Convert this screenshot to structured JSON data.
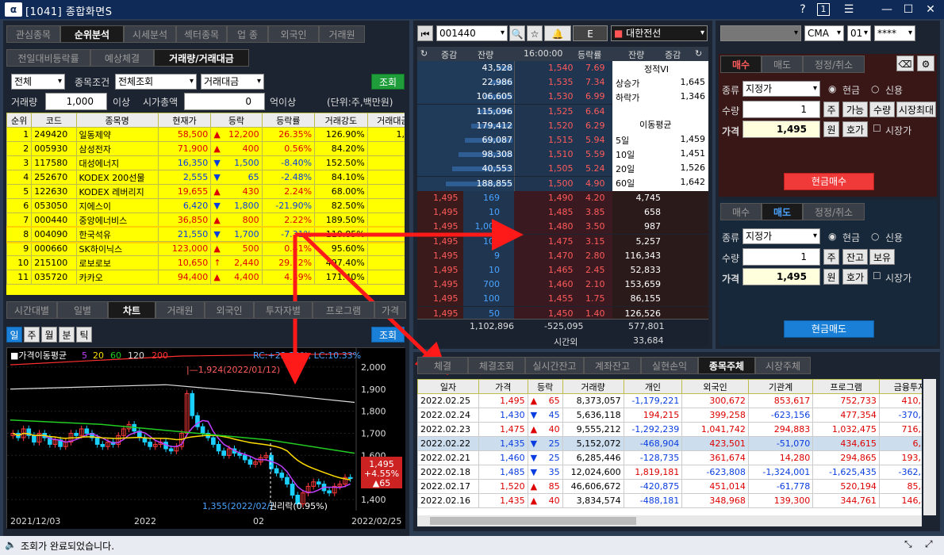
{
  "title": "[1041] 종합화면S",
  "title_buttons": [
    "?",
    "1",
    "☰",
    "—",
    "☐",
    "✕"
  ],
  "left": {
    "tabs1": [
      "관심종목",
      "순위분석",
      "시세분석",
      "섹터종목",
      "업 종",
      "외국인",
      "거래원"
    ],
    "tabs2": [
      "전일대비등락률",
      "예상체결",
      "거래량/거래대금"
    ],
    "market": "전체",
    "cond_label": "종목조건",
    "cond": "전체조회",
    "sort": "거래대금",
    "search": "조회",
    "vol_label": "거래량",
    "vol": "1,000",
    "vol_unit": "이상",
    "amt_label": "시가총액",
    "amt": "0",
    "amt_unit": "억이상",
    "unit": "(단위:주,백만원)",
    "cols": [
      "순위",
      "코드",
      "종목명",
      "현재가",
      "등락",
      "등락률",
      "거래강도",
      "거래대금"
    ],
    "rows": [
      [
        "1",
        "249420",
        "일동제약",
        "58,500",
        "▲",
        "12,200",
        "26.35%",
        "126.90%",
        "1,05"
      ],
      [
        "2",
        "005930",
        "삼성전자",
        "71,900",
        "▲",
        "400",
        "0.56%",
        "84.20%",
        "95"
      ],
      [
        "3",
        "117580",
        "대성에너지",
        "16,350",
        "▼",
        "1,500",
        "-8.40%",
        "152.50%",
        "70"
      ],
      [
        "4",
        "252670",
        "KODEX 200선물",
        "2,555",
        "▼",
        "65",
        "-2.48%",
        "84.10%",
        "60"
      ],
      [
        "5",
        "122630",
        "KODEX 레버리지",
        "19,655",
        "▲",
        "430",
        "2.24%",
        "68.00%",
        "50"
      ],
      [
        "6",
        "053050",
        "지에스이",
        "6,420",
        "▼",
        "1,800",
        "-21.90%",
        "82.50%",
        "50"
      ],
      [
        "7",
        "000440",
        "중앙에너비스",
        "36,850",
        "▲",
        "800",
        "2.22%",
        "189.50%",
        "43"
      ],
      [
        "8",
        "004090",
        "한국석유",
        "21,550",
        "▼",
        "1,700",
        "-7.31%",
        "110.85%",
        "42"
      ],
      [
        "9",
        "000660",
        "SK하이닉스",
        "123,000",
        "▲",
        "500",
        "0.41%",
        "95.60%",
        "41"
      ],
      [
        "10",
        "215100",
        "로보로보",
        "10,650",
        "↑",
        "2,440",
        "29.72%",
        "497.40%",
        "37"
      ],
      [
        "11",
        "035720",
        "카카오",
        "94,400",
        "▲",
        "4,400",
        "4.89%",
        "171.40%",
        "34"
      ]
    ],
    "tabs3": [
      "시간대별",
      "일별",
      "차트",
      "거래원",
      "외국인",
      "투자자별",
      "프로그램",
      "가격"
    ],
    "periods": [
      "일",
      "주",
      "월",
      "분",
      "틱"
    ],
    "search2": "조회",
    "chart": {
      "legend": "가격이동평균",
      "ma": [
        "5",
        "20",
        "60",
        "120",
        "200"
      ],
      "rc": "RC:+22.29%, LC:10.33%",
      "high_note": "1,924(2022/01/12)",
      "low_note": "1,355(2022/02/)",
      "event": "권리락(0.95%)",
      "last": "1,495",
      "chg": "+4.55%",
      "chg2": "▲65",
      "yticks": [
        "2,000",
        "1,900",
        "1,800",
        "1,700",
        "1,600",
        "1,500",
        "1,400"
      ],
      "xticks": [
        "2021/12/03",
        "2022",
        "02",
        "2022/02/25"
      ]
    }
  },
  "mid": {
    "code": "001440",
    "btn_e": "E",
    "name": "대한전선",
    "time": "16:00:00",
    "hdr": [
      "증감",
      "잔량",
      "16:00:00",
      "등락률",
      "잔량",
      "증감"
    ],
    "asks": [
      [
        "43,528",
        "1,540",
        "7.69"
      ],
      [
        "22,986",
        "1,535",
        "7.34"
      ],
      [
        "106,605",
        "1,530",
        "6.99"
      ],
      [
        "115,096",
        "1,525",
        "6.64"
      ],
      [
        "179,412",
        "1,520",
        "6.29"
      ],
      [
        "69,087",
        "1,515",
        "5.94"
      ],
      [
        "98,308",
        "1,510",
        "5.59"
      ],
      [
        "40,553",
        "1,505",
        "5.24"
      ],
      [
        "188,855",
        "1,500",
        "4.90"
      ],
      [
        "238,466",
        "1,495",
        "4.55"
      ]
    ],
    "bids": [
      [
        "1,495",
        "169",
        "1,490",
        "4.20",
        "4,745"
      ],
      [
        "1,495",
        "10",
        "1,485",
        "3.85",
        "658"
      ],
      [
        "1,495",
        "1,000",
        "1,480",
        "3.50",
        "987"
      ],
      [
        "1,495",
        "100",
        "1,475",
        "3.15",
        "5,257"
      ],
      [
        "1,495",
        "9",
        "1,470",
        "2.80",
        "116,343"
      ],
      [
        "1,495",
        "10",
        "1,465",
        "2.45",
        "52,833"
      ],
      [
        "1,495",
        "700",
        "1,460",
        "2.10",
        "153,659"
      ],
      [
        "1,495",
        "100",
        "1,455",
        "1.75",
        "86,155"
      ],
      [
        "1,495",
        "50",
        "1,450",
        "1.40",
        "126,526"
      ],
      [
        "1,495",
        "1,933",
        "1,445",
        "1.05",
        "30,638"
      ]
    ],
    "info": [
      [
        "정적VI",
        ""
      ],
      [
        "상승가",
        "1,645"
      ],
      [
        "하락가",
        "1,346"
      ]
    ],
    "ma_title": "이동평균",
    "ma": [
      [
        "5일",
        "1,459"
      ],
      [
        "10일",
        "1,451"
      ],
      [
        "20일",
        "1,526"
      ],
      [
        "60일",
        "1,642"
      ]
    ],
    "tot_ask": "1,102,896",
    "tot_diff": "-525,095",
    "tot_bid": "577,801",
    "after": "시간외",
    "after_val": "33,684"
  },
  "right": {
    "acct": "CMA",
    "sub": "01",
    "pw": "****",
    "buy_tabs": [
      "매수",
      "매도",
      "정정/취소"
    ],
    "kind_label": "종류",
    "kind": "지정가",
    "cash": "현금",
    "credit": "신용",
    "qty_label": "수량",
    "qty": "1",
    "price_label": "가격",
    "price": "1,495",
    "b_ju": "주",
    "b_avail": "가능",
    "b_qty": "수량",
    "b_max": "시장최대",
    "b_won": "원",
    "b_ho": "호가",
    "market_price": "시장가",
    "buy_btn": "현금매수",
    "sell_btn": "현금매도",
    "b_jan": "잔고",
    "b_bo": "보유"
  },
  "bottom": {
    "tabs": [
      "체결",
      "체결조회",
      "실시간잔고",
      "계좌잔고",
      "실현손익",
      "종목주체",
      "시장주체"
    ],
    "cols": [
      "일자",
      "가격",
      "등락",
      "거래량",
      "개인",
      "외국인",
      "기관계",
      "프로그램",
      "금융투자"
    ],
    "rows": [
      [
        "2022.02.25",
        "1,495",
        "▲",
        "65",
        "8,373,057",
        "-1,179,221",
        "300,672",
        "853,617",
        "752,733",
        "410,910"
      ],
      [
        "2022.02.24",
        "1,430",
        "▼",
        "45",
        "5,636,118",
        "194,215",
        "399,258",
        "-623,156",
        "477,354",
        "-370,885"
      ],
      [
        "2022.02.23",
        "1,475",
        "▲",
        "40",
        "9,555,212",
        "-1,292,239",
        "1,041,742",
        "294,883",
        "1,032,475",
        "716,227"
      ],
      [
        "2022.02.22",
        "1,435",
        "▼",
        "25",
        "5,152,072",
        "-468,904",
        "423,501",
        "-51,070",
        "434,615",
        "6,356"
      ],
      [
        "2022.02.21",
        "1,460",
        "▼",
        "25",
        "6,285,446",
        "-128,735",
        "361,674",
        "14,280",
        "294,865",
        "193,154"
      ],
      [
        "2022.02.18",
        "1,485",
        "▼",
        "35",
        "12,024,600",
        "1,819,181",
        "-623,808",
        "-1,324,001",
        "-1,625,435",
        "-362,390"
      ],
      [
        "2022.02.17",
        "1,520",
        "▲",
        "85",
        "46,606,672",
        "-420,875",
        "451,014",
        "-61,778",
        "520,194",
        "85,873"
      ],
      [
        "2022.02.16",
        "1,435",
        "▲",
        "40",
        "3,834,574",
        "-488,181",
        "348,968",
        "139,300",
        "344,761",
        "146,812"
      ]
    ]
  },
  "status": "조회가 완료되었습니다."
}
